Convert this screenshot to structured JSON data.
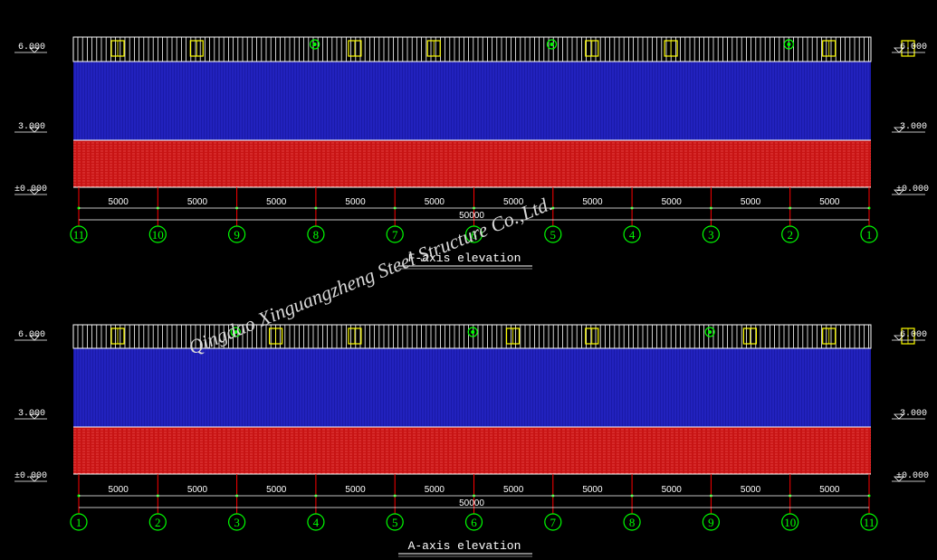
{
  "elevations": [
    {
      "title": "F-axis elevation",
      "levels": {
        "top": "6.000",
        "mid": "3.000",
        "ground": "±0.000"
      },
      "axes": [
        "11",
        "10",
        "9",
        "8",
        "7",
        "6",
        "5",
        "4",
        "3",
        "2",
        "1"
      ],
      "bay_dims": [
        "5000",
        "5000",
        "5000",
        "5000",
        "5000",
        "5000",
        "5000",
        "5000",
        "5000",
        "5000"
      ],
      "total_dim": "50000"
    },
    {
      "title": "A-axis elevation",
      "levels": {
        "top": "6.000",
        "mid": "3.000",
        "ground": "±0.000"
      },
      "axes": [
        "1",
        "2",
        "3",
        "4",
        "5",
        "6",
        "7",
        "8",
        "9",
        "10",
        "11"
      ],
      "bay_dims": [
        "5000",
        "5000",
        "5000",
        "5000",
        "5000",
        "5000",
        "5000",
        "5000",
        "5000",
        "5000"
      ],
      "total_dim": "50000"
    }
  ],
  "watermark": "Qingdao Xinguangzheng Steel Structure Co.,Ltd.",
  "colors": {
    "background": "#000000",
    "wall_panel": "#1a1aa8",
    "brick_base": "#c81414",
    "axis_circle": "#00ff00",
    "column_line": "#ff0000",
    "window": "#ffff00"
  }
}
